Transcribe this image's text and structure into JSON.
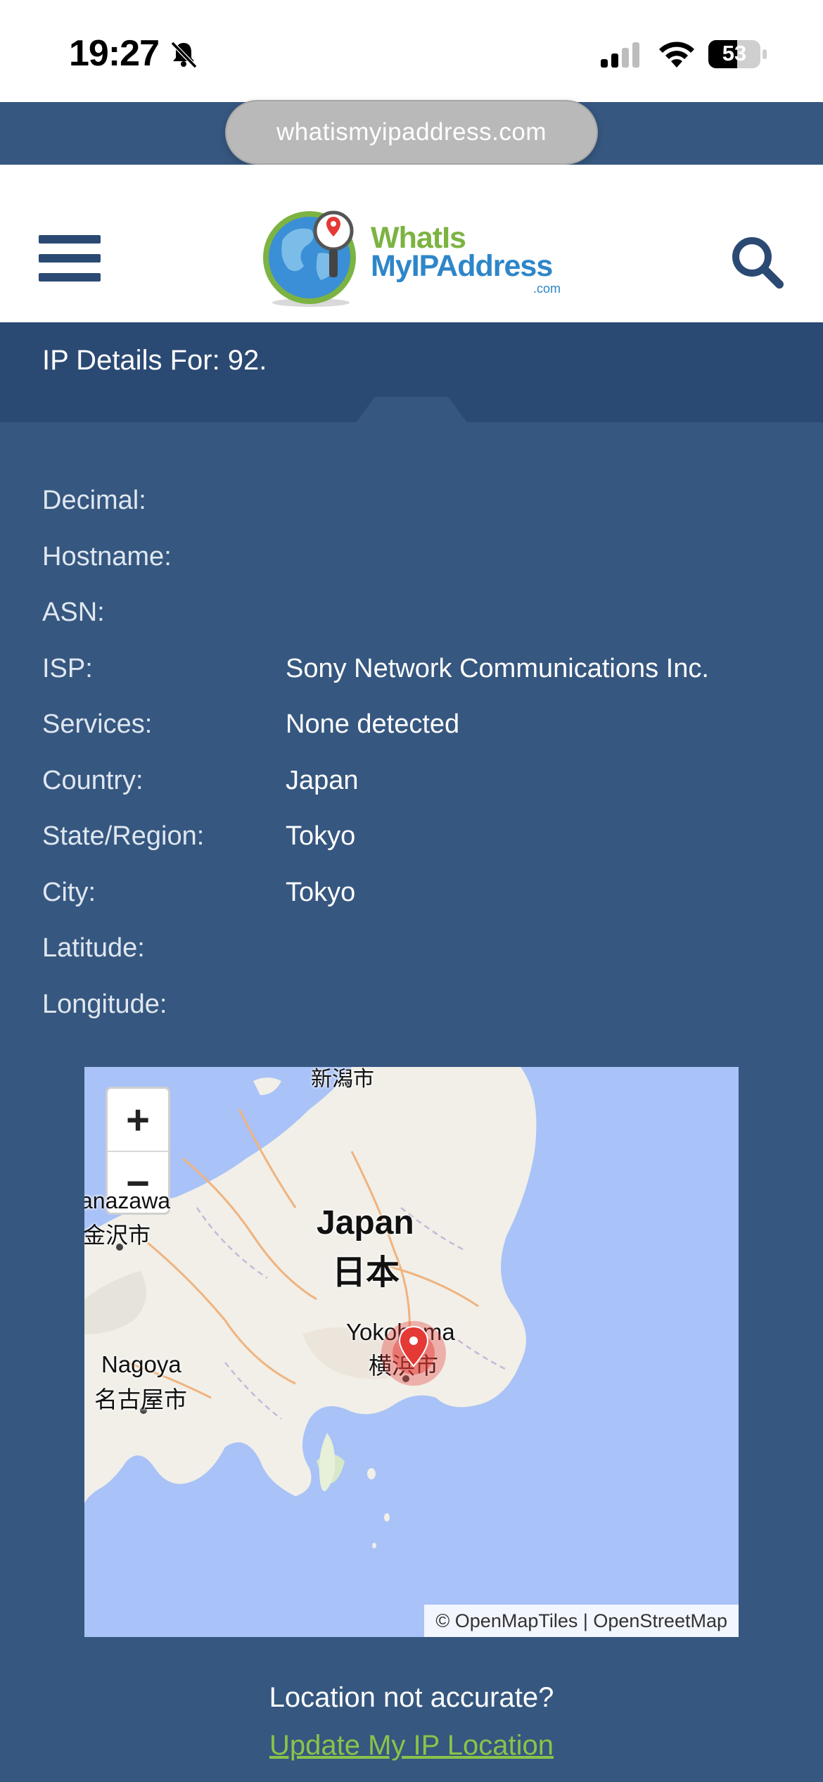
{
  "status_bar": {
    "time": "19:27",
    "battery_level": "53",
    "icons": [
      "bell-slash-icon",
      "cellular-signal-icon",
      "wifi-icon",
      "battery-icon"
    ]
  },
  "browser": {
    "url": "whatismyipaddress.com"
  },
  "header": {
    "logo_line1": "WhatIs",
    "logo_line2": "MyIPAddress",
    "logo_suffix": ".com",
    "colors": {
      "brand_dark": "#2b4a73",
      "brand_green": "#7cb342",
      "brand_blue": "#2e86c9"
    }
  },
  "ip_details": {
    "title": "IP Details For: 92.",
    "rows": [
      {
        "label": "Decimal:",
        "value": ""
      },
      {
        "label": "Hostname:",
        "value": ""
      },
      {
        "label": "ASN:",
        "value": ""
      },
      {
        "label": "ISP:",
        "value": "Sony Network Communications Inc."
      },
      {
        "label": "Services:",
        "value": "None detected"
      },
      {
        "label": "Country:",
        "value": "Japan"
      },
      {
        "label": "State/Region:",
        "value": "Tokyo"
      },
      {
        "label": "City:",
        "value": "Tokyo"
      },
      {
        "label": "Latitude:",
        "value": ""
      },
      {
        "label": "Longitude:",
        "value": ""
      }
    ]
  },
  "map": {
    "zoom_in": "+",
    "zoom_out": "−",
    "labels": {
      "niigata": "新潟市",
      "kanazawa_en": "anazawa",
      "kanazawa_ja": "金沢市",
      "country_en": "Japan",
      "country_ja": "日本",
      "yokohama_en": "Yokohama",
      "yokohama_ja": "横浜市",
      "nagoya_en": "Nagoya",
      "nagoya_ja": "名古屋市"
    },
    "attribution": "© OpenMapTiles | OpenStreetMap"
  },
  "footer": {
    "question": "Location not accurate?",
    "link": "Update My IP Location"
  }
}
